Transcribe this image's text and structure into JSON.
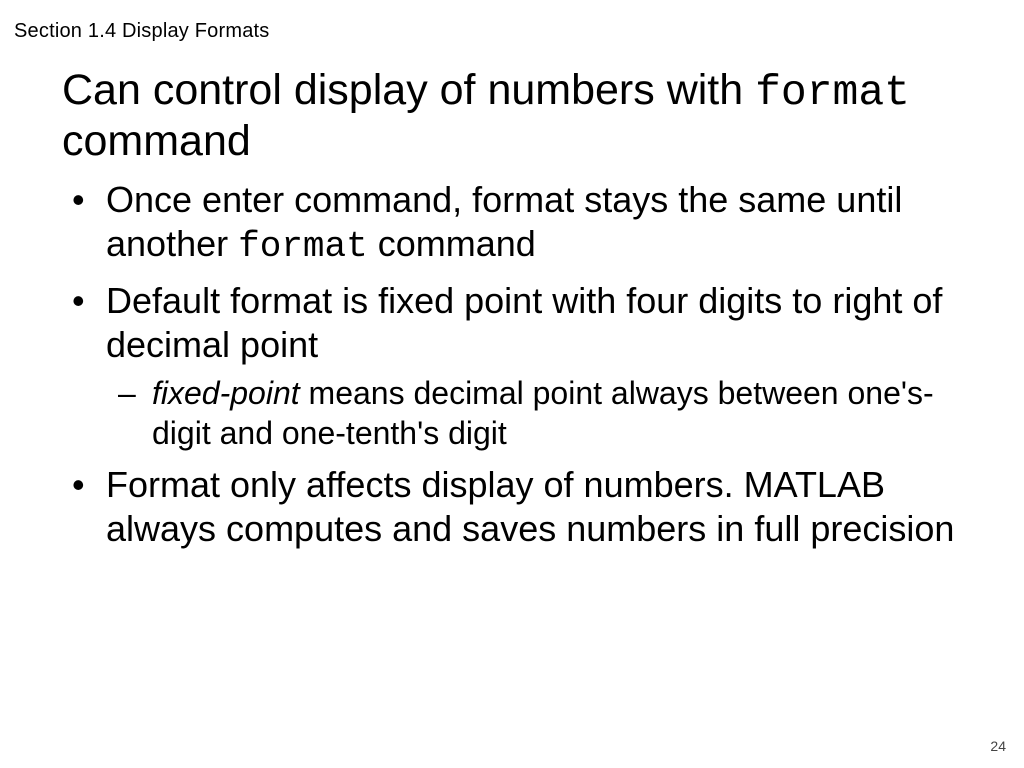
{
  "section_header": "Section 1.4 Display Formats",
  "title": {
    "part1": "Can control display of numbers with ",
    "code": "format",
    "part2": " command"
  },
  "bullets": {
    "b1": {
      "a": "Once enter command, format stays the same until another ",
      "code": "format",
      "b": " command"
    },
    "b2": "Default format is fixed point with four digits to right of decimal point",
    "b2_sub": {
      "em": "fixed-point",
      "rest": " means decimal point always between one's-digit and one-tenth's digit"
    },
    "b3": "Format only affects display of numbers. MATLAB always computes and saves numbers in full precision"
  },
  "page_number": "24"
}
